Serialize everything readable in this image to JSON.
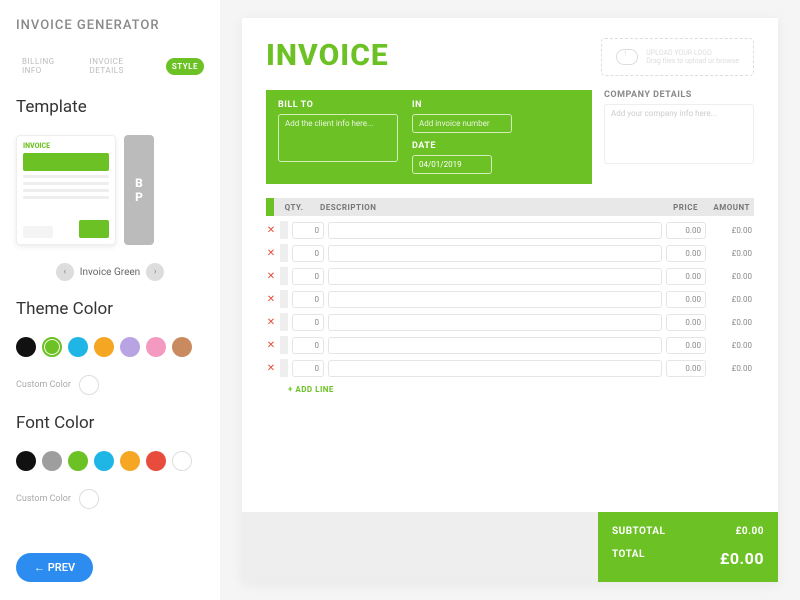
{
  "app_title": "INVOICE GENERATOR",
  "tabs": {
    "billing": "BILLING INFO",
    "details": "INVOICE DETAILS",
    "style": "STYLE"
  },
  "sections": {
    "template": "Template",
    "theme_color": "Theme Color",
    "font_color": "Font Color"
  },
  "template": {
    "name": "Invoice Green",
    "prev_glyph": "‹",
    "next_glyph": "›"
  },
  "theme_colors": [
    "#111111",
    "#6cc124",
    "#1fb6e6",
    "#f5a623",
    "#b8a3e3",
    "#f49ac1",
    "#c98a5f"
  ],
  "font_colors": [
    "#111111",
    "#9e9e9e",
    "#6cc124",
    "#1fb6e6",
    "#f5a623",
    "#e74c3c",
    "#ffffff"
  ],
  "custom_label": "Custom Color",
  "prev_button": "←  PREV",
  "invoice": {
    "title": "INVOICE",
    "logo": {
      "line1": "UPLOAD YOUR LOGO",
      "line2": "Drag files to upload or browse"
    },
    "bill_to_label": "BILL TO",
    "bill_to_placeholder": "Add the client info here...",
    "in_label": "IN",
    "in_placeholder": "Add invoice number",
    "date_label": "DATE",
    "date_value": "04/01/2019",
    "company_label": "COMPANY DETAILS",
    "company_placeholder": "Add your company info here...",
    "columns": {
      "qty": "QTY.",
      "desc": "DESCRIPTION",
      "price": "PRICE",
      "amount": "AMOUNT"
    },
    "lines": [
      {
        "qty": "0",
        "price": "0.00",
        "amount": "£0.00"
      },
      {
        "qty": "0",
        "price": "0.00",
        "amount": "£0.00"
      },
      {
        "qty": "0",
        "price": "0.00",
        "amount": "£0.00"
      },
      {
        "qty": "0",
        "price": "0.00",
        "amount": "£0.00"
      },
      {
        "qty": "0",
        "price": "0.00",
        "amount": "£0.00"
      },
      {
        "qty": "0",
        "price": "0.00",
        "amount": "£0.00"
      },
      {
        "qty": "0",
        "price": "0.00",
        "amount": "£0.00"
      }
    ],
    "add_line": "+ ADD LINE",
    "subtotal_label": "SUBTOTAL",
    "subtotal_value": "£0.00",
    "total_label": "TOTAL",
    "total_value": "£0.00"
  }
}
